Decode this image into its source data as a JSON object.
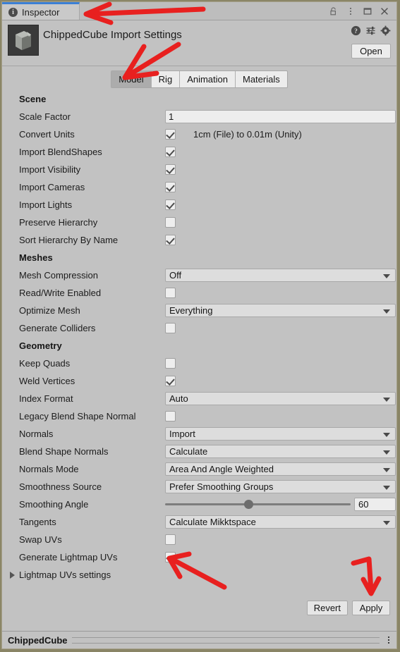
{
  "window": {
    "tab_label": "Inspector",
    "tab_icon": "info-icon",
    "controls": [
      {
        "name": "lock-icon",
        "label": "Lock"
      },
      {
        "name": "kebab-menu-icon",
        "label": "More"
      },
      {
        "name": "maximize-icon",
        "label": "Maximize"
      },
      {
        "name": "close-icon",
        "label": "Close"
      }
    ]
  },
  "asset_header": {
    "title": "ChippedCube Import Settings",
    "thumbnail_name": "chipped-cube-thumbnail",
    "icons": [
      {
        "name": "help-icon",
        "label": "Help"
      },
      {
        "name": "preset-icon",
        "label": "Preset"
      },
      {
        "name": "gear-icon",
        "label": "Settings"
      }
    ],
    "open_button": "Open"
  },
  "tabs": [
    {
      "label": "Model",
      "active": true
    },
    {
      "label": "Rig",
      "active": false
    },
    {
      "label": "Animation",
      "active": false
    },
    {
      "label": "Materials",
      "active": false
    }
  ],
  "sections": [
    {
      "heading": "Scene",
      "rows": [
        {
          "label": "Scale Factor",
          "type": "text",
          "value": "1"
        },
        {
          "label": "Convert Units",
          "type": "checkbox",
          "checked": true,
          "side_text": "1cm (File) to 0.01m (Unity)"
        },
        {
          "label": "Import BlendShapes",
          "type": "checkbox",
          "checked": true
        },
        {
          "label": "Import Visibility",
          "type": "checkbox",
          "checked": true
        },
        {
          "label": "Import Cameras",
          "type": "checkbox",
          "checked": true
        },
        {
          "label": "Import Lights",
          "type": "checkbox",
          "checked": true
        },
        {
          "label": "Preserve Hierarchy",
          "type": "checkbox",
          "checked": false
        },
        {
          "label": "Sort Hierarchy By Name",
          "type": "checkbox",
          "checked": true
        }
      ]
    },
    {
      "heading": "Meshes",
      "rows": [
        {
          "label": "Mesh Compression",
          "type": "dropdown",
          "value": "Off"
        },
        {
          "label": "Read/Write Enabled",
          "type": "checkbox",
          "checked": false
        },
        {
          "label": "Optimize Mesh",
          "type": "dropdown",
          "value": "Everything"
        },
        {
          "label": "Generate Colliders",
          "type": "checkbox",
          "checked": false
        }
      ]
    },
    {
      "heading": "Geometry",
      "rows": [
        {
          "label": "Keep Quads",
          "type": "checkbox",
          "checked": false
        },
        {
          "label": "Weld Vertices",
          "type": "checkbox",
          "checked": true
        },
        {
          "label": "Index Format",
          "type": "dropdown",
          "value": "Auto"
        },
        {
          "label": "Legacy Blend Shape Normal",
          "type": "checkbox",
          "checked": false
        },
        {
          "label": "Normals",
          "type": "dropdown",
          "value": "Import"
        },
        {
          "label": "Blend Shape Normals",
          "type": "dropdown",
          "value": "Calculate"
        },
        {
          "label": "Normals Mode",
          "type": "dropdown",
          "value": "Area And Angle Weighted"
        },
        {
          "label": "Smoothness Source",
          "type": "dropdown",
          "value": "Prefer Smoothing Groups"
        },
        {
          "label": "Smoothing Angle",
          "type": "slider",
          "value": "60",
          "fill_percent": 45
        },
        {
          "label": "Tangents",
          "type": "dropdown",
          "value": "Calculate Mikktspace"
        },
        {
          "label": "Swap UVs",
          "type": "checkbox",
          "checked": false
        },
        {
          "label": "Generate Lightmap UVs",
          "type": "checkbox",
          "checked": true
        },
        {
          "label": "Lightmap UVs settings",
          "type": "foldout",
          "expanded": false
        }
      ]
    }
  ],
  "footer": {
    "revert_label": "Revert",
    "apply_label": "Apply"
  },
  "statusbar": {
    "label": "ChippedCube"
  },
  "annotations": {
    "color": "#e8201f",
    "marks": [
      {
        "name": "arrow-to-inspector-tab"
      },
      {
        "name": "arrow-to-model-tab"
      },
      {
        "name": "arrow-to-generate-lightmap-uvs-checkbox"
      },
      {
        "name": "arrow-to-apply-button"
      }
    ]
  },
  "colors": {
    "panel_bg": "#c2c2c2",
    "field_bg": "#ededed",
    "dropdown_bg": "#dddddd",
    "active_tab_bg": "#acacac",
    "tab_accent": "#3b7fd4",
    "annotation_red": "#e8201f"
  }
}
